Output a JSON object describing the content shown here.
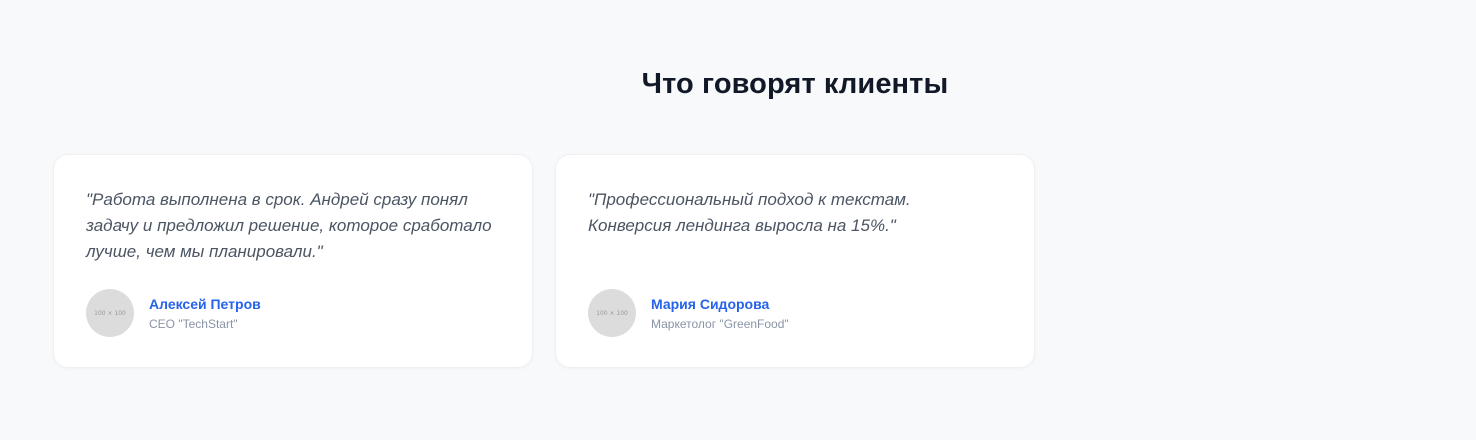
{
  "section": {
    "title": "Что говорят клиенты"
  },
  "testimonials": [
    {
      "quote": "\"Работа выполнена в срок. Андрей сразу понял задачу и предложил решение, которое сработало лучше, чем мы планировали.\"",
      "avatar_text": "100 × 100",
      "name": "Алексей Петров",
      "role": "CEO \"TechStart\""
    },
    {
      "quote": "\"Профессиональный подход к текстам. Конверсия лендинга выросла на 15%.\"",
      "avatar_text": "100 × 100",
      "name": "Мария Сидорова",
      "role": "Маркетолог \"GreenFood\""
    }
  ],
  "colors": {
    "background": "#f8f9fb",
    "card": "#ffffff",
    "heading": "#111827",
    "quote_text": "#4b5563",
    "author_name": "#2563eb",
    "author_role": "#8a94a6",
    "avatar_placeholder": "#dcdcdc"
  }
}
